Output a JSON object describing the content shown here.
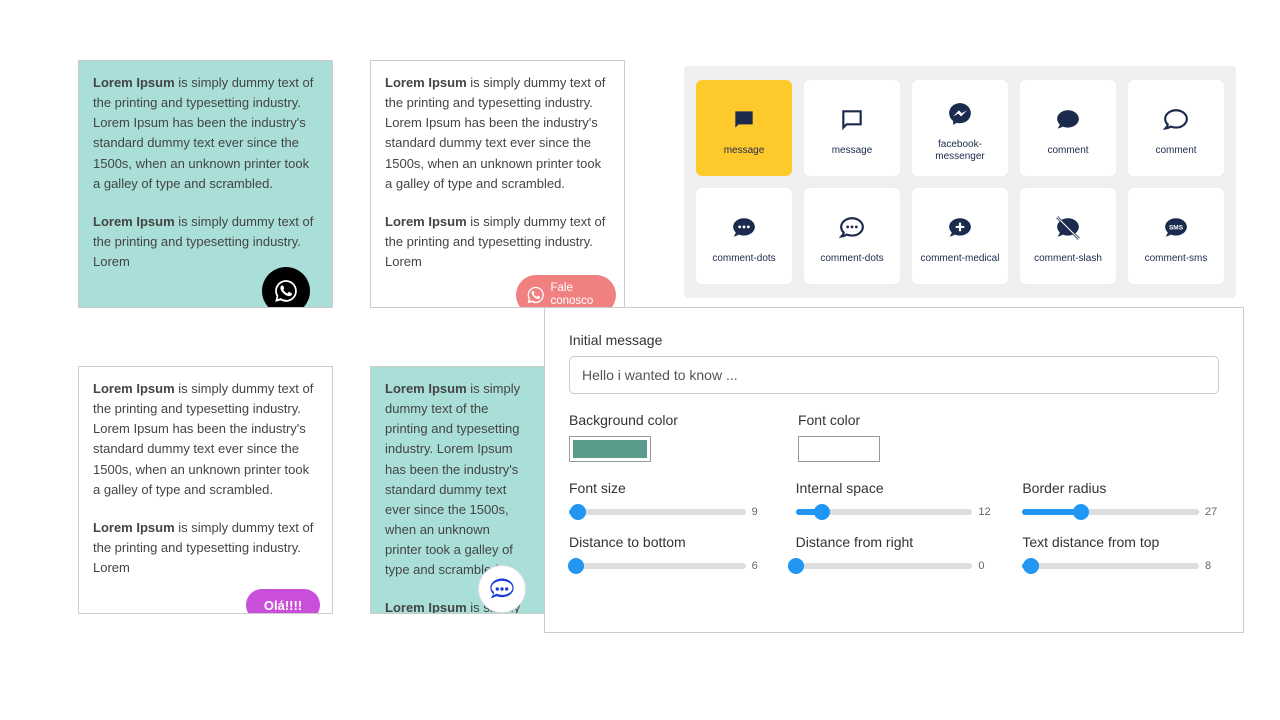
{
  "previews": {
    "paragraph1": "Lorem Ipsum is simply dummy text of the printing and typesetting industry. Lorem Ipsum has been the industry's standard dummy text ever since the 1500s, when an unknown printer took a galley of type and scrambled.",
    "paragraph2": "Lorem Ipsum is simply dummy text of the printing and typesetting industry. Lorem",
    "bold": "Lorem Ipsum",
    "buttons": {
      "fale_conosco": "Fale conosco",
      "ola": "Olá!!!!"
    }
  },
  "icons": [
    {
      "name": "message",
      "label": "message",
      "active": true
    },
    {
      "name": "message-outline",
      "label": "message"
    },
    {
      "name": "facebook-messenger",
      "label": "facebook-messenger"
    },
    {
      "name": "comment",
      "label": "comment"
    },
    {
      "name": "comment-outline",
      "label": "comment"
    },
    {
      "name": "comment-dots",
      "label": "comment-dots"
    },
    {
      "name": "comment-dots-outline",
      "label": "comment-dots"
    },
    {
      "name": "comment-medical",
      "label": "comment-medical"
    },
    {
      "name": "comment-slash",
      "label": "comment-slash"
    },
    {
      "name": "comment-sms",
      "label": "comment-sms"
    }
  ],
  "settings": {
    "initial_message_label": "Initial message",
    "initial_message_value": "Hello i wanted to know ...",
    "background_color_label": "Background color",
    "background_color": "#5b9b8b",
    "font_color_label": "Font color",
    "font_color": "#ffffff",
    "sliders": {
      "font_size": {
        "label": "Font size",
        "value": 9,
        "max": 100,
        "pct": 5
      },
      "internal_space": {
        "label": "Internal space",
        "value": 12,
        "max": 100,
        "pct": 15
      },
      "border_radius": {
        "label": "Border radius",
        "value": 27,
        "max": 100,
        "pct": 33
      },
      "distance_bottom": {
        "label": "Distance to bottom",
        "value": 6,
        "max": 100,
        "pct": 4
      },
      "distance_right": {
        "label": "Distance from right",
        "value": 0,
        "max": 100,
        "pct": 0
      },
      "text_distance_top": {
        "label": "Text distance from top",
        "value": 8,
        "max": 100,
        "pct": 5
      }
    }
  }
}
